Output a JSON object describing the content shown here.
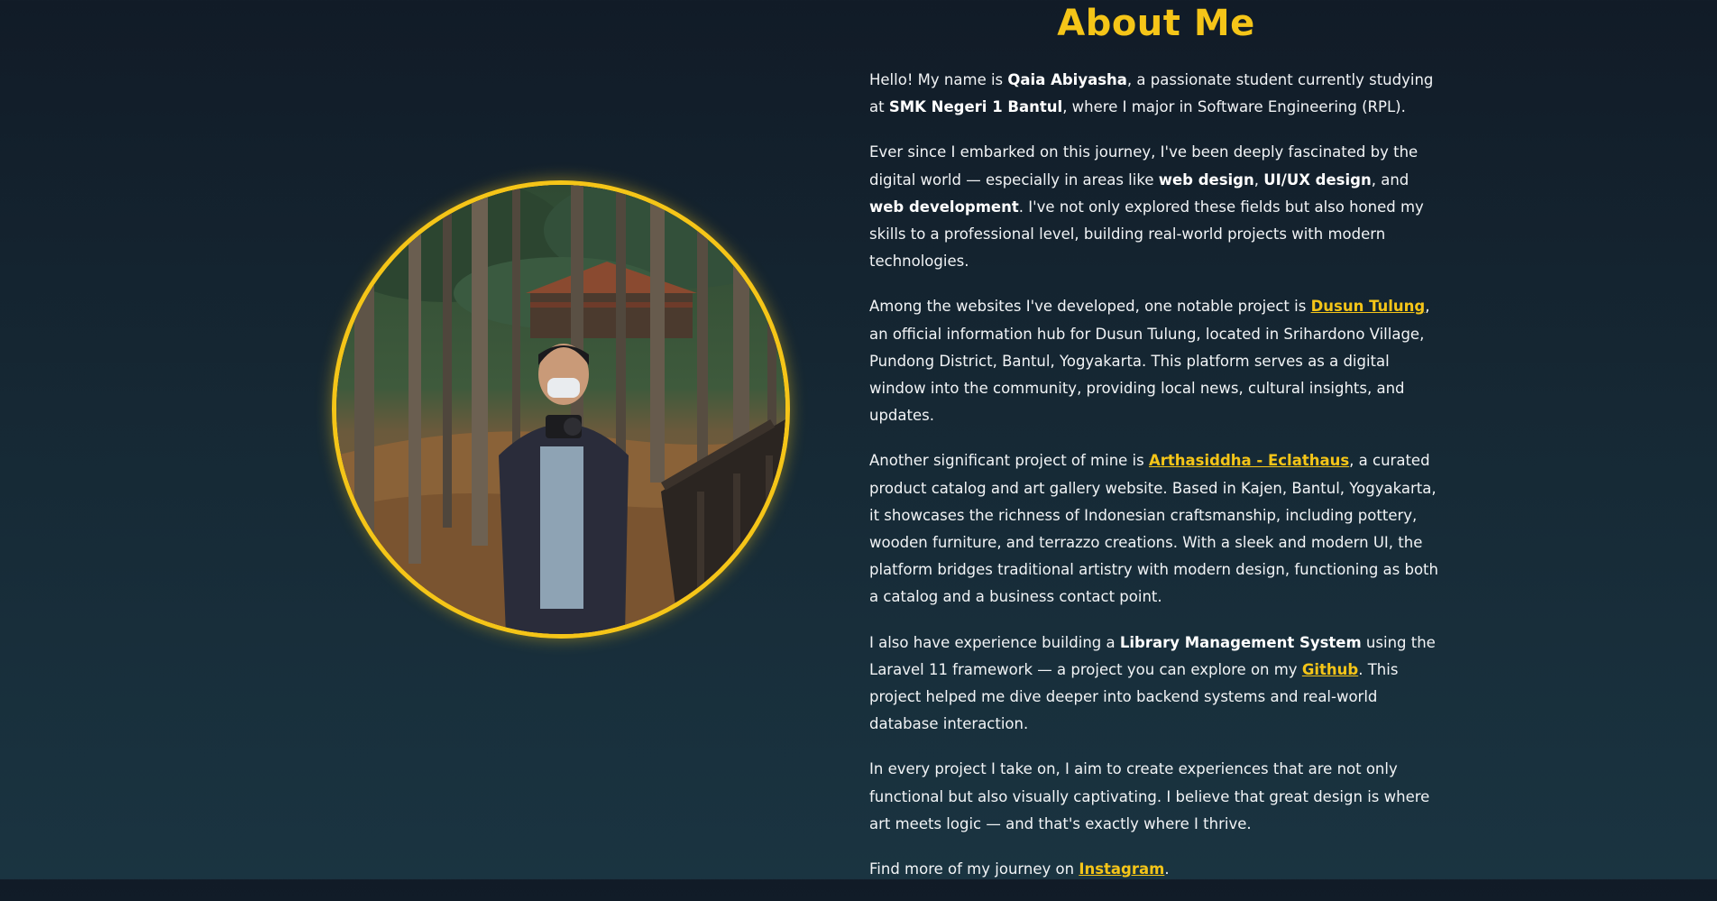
{
  "page": {
    "title": "About Me"
  },
  "colors": {
    "accent": "#f5c518",
    "background_top": "#111b27",
    "background_bottom": "#1a3441",
    "text": "#f2f4f6"
  },
  "profile_photo": {
    "icon": "profile-photo"
  },
  "paragraphs": {
    "p1": {
      "t1": "Hello! My name is ",
      "name": "Qaia Abiyasha",
      "t2": ", a passionate student currently studying at ",
      "school": "SMK Negeri 1 Bantul",
      "t3": ", where I major in Software Engineering (RPL)."
    },
    "p2": {
      "t1": "Ever since I embarked on this journey, I've been deeply fascinated by the digital world — especially in areas like ",
      "b1": "web design",
      "t2": ", ",
      "b2": "UI/UX design",
      "t3": ", and ",
      "b3": "web development",
      "t4": ". I've not only explored these fields but also honed my skills to a professional level, building real-world projects with modern technologies."
    },
    "p3": {
      "t1": "Among the websites I've developed, one notable project is ",
      "link": "Dusun Tulung",
      "t2": ", an official information hub for Dusun Tulung, located in Srihardono Village, Pundong District, Bantul, Yogyakarta. This platform serves as a digital window into the community, providing local news, cultural insights, and updates."
    },
    "p4": {
      "t1": "Another significant project of mine is ",
      "link": "Arthasiddha - Eclathaus",
      "t2": ", a curated product catalog and art gallery website. Based in Kajen, Bantul, Yogyakarta, it showcases the richness of Indonesian craftsmanship, including pottery, wooden furniture, and terrazzo creations. With a sleek and modern UI, the platform bridges traditional artistry with modern design, functioning as both a catalog and a business contact point."
    },
    "p5": {
      "t1": "I also have experience building a ",
      "b1": "Library Management System",
      "t2": " using the Laravel 11 framework — a project you can explore on my ",
      "link": "Github",
      "t3": ". This project helped me dive deeper into backend systems and real-world database interaction."
    },
    "p6": {
      "t1": "In every project I take on, I aim to create experiences that are not only functional but also visually captivating. I believe that great design is where art meets logic — and that's exactly where I thrive."
    },
    "p7": {
      "t1": "Find more of my journey on ",
      "link": "Instagram",
      "t2": "."
    }
  }
}
